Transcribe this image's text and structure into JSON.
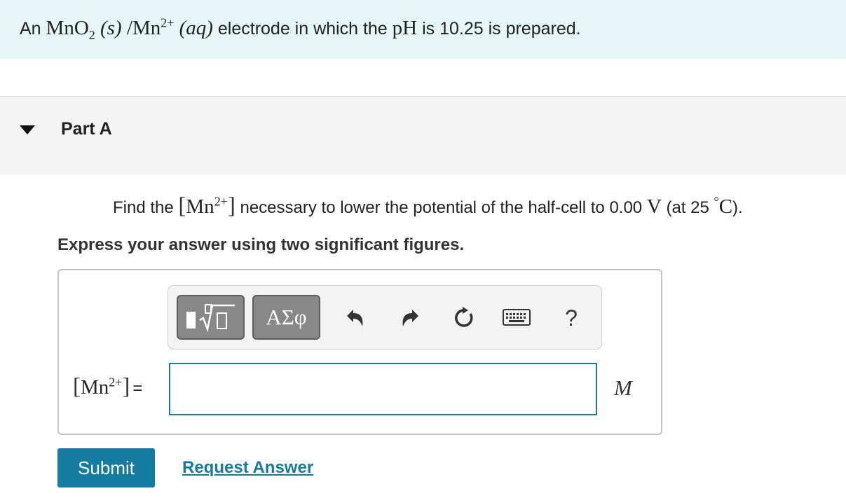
{
  "problem": {
    "prefix": "An",
    "electrode_formula": "MnO",
    "electrode_sub": "2",
    "solid_state": "(s)",
    "separator": "/",
    "ion": "Mn",
    "ion_charge": "2+",
    "aq_state": "(aq)",
    "middle": "electrode in which the",
    "ph_symbol": "pH",
    "suffix": "is 10.25 is prepared."
  },
  "part": {
    "title": "Part A",
    "question": {
      "prefix": "Find the",
      "ion": "Mn",
      "ion_charge": "2+",
      "middle": "necessary to lower the potential of the half-cell to 0.00",
      "unit_v": "V",
      "temp_text": "(at 25",
      "degree": "°",
      "celsius": "C",
      "end": ")."
    },
    "instruction": "Express your answer using two significant figures."
  },
  "toolbar": {
    "symbols_label": "ΑΣφ",
    "help_label": "?"
  },
  "answer": {
    "lhs_ion": "Mn",
    "lhs_charge": "2+",
    "equals": "=",
    "value": "",
    "unit": "M"
  },
  "actions": {
    "submit_label": "Submit",
    "request_label": "Request Answer"
  }
}
